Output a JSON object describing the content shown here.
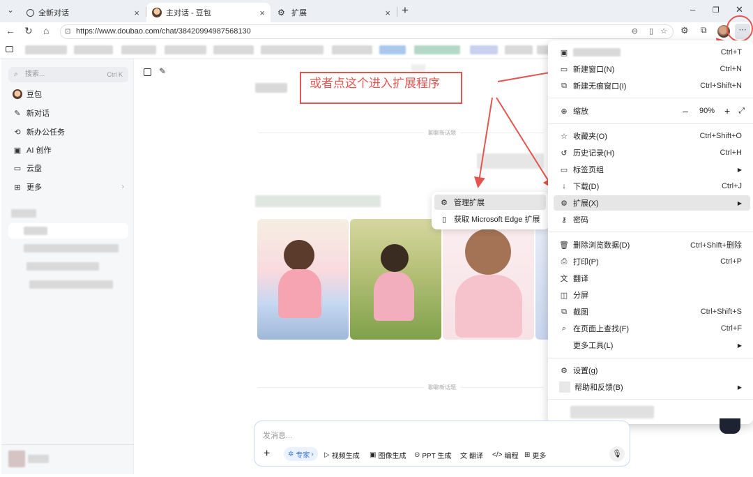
{
  "tabs": [
    {
      "title": "全新对话"
    },
    {
      "title": "主对话 - 豆包"
    },
    {
      "title": "扩展"
    }
  ],
  "address": {
    "url": "https://www.doubao.com/chat/38420994987568130"
  },
  "sidebar": {
    "search_placeholder": "搜索...",
    "search_shortcut": "Ctrl K",
    "items": [
      {
        "label": "豆包",
        "icon": "doubao-avatar-icon"
      },
      {
        "label": "新对话",
        "icon": "edit-icon"
      },
      {
        "label": "新办公任务",
        "icon": "office-task-icon"
      },
      {
        "label": "AI 创作",
        "icon": "image-icon"
      },
      {
        "label": "云盘",
        "icon": "folder-icon"
      },
      {
        "label": "更多",
        "icon": "grid-icon"
      }
    ]
  },
  "main": {
    "divider_text": "聊聊新话题",
    "annotation": "或者点这个进入扩展程序"
  },
  "input": {
    "placeholder": "发消息...",
    "tools": [
      "专家",
      "视频生成",
      "图像生成",
      "PPT 生成",
      "翻译",
      "编程",
      "更多"
    ]
  },
  "submenu": {
    "items": [
      {
        "label": "管理扩展",
        "icon": "puzzle-icon"
      },
      {
        "label": "获取 Microsoft Edge 扩展",
        "icon": "store-icon"
      }
    ]
  },
  "menu": {
    "new_tab_shortcut": "Ctrl+T",
    "items": [
      {
        "label": "新建窗口(N)",
        "shortcut": "Ctrl+N",
        "icon": "window-icon"
      },
      {
        "label": "新建无痕窗口(I)",
        "shortcut": "Ctrl+Shift+N",
        "icon": "inprivate-icon"
      },
      {
        "label": "缩放",
        "zoom": "90%",
        "icon": "zoom-icon"
      },
      {
        "label": "收藏夹(O)",
        "shortcut": "Ctrl+Shift+O",
        "icon": "star-icon"
      },
      {
        "label": "历史记录(H)",
        "shortcut": "Ctrl+H",
        "icon": "history-icon"
      },
      {
        "label": "标签页组",
        "shortcut": "",
        "icon": "tab-group-icon"
      },
      {
        "label": "下载(D)",
        "shortcut": "Ctrl+J",
        "icon": "download-icon"
      },
      {
        "label": "扩展(X)",
        "shortcut": "",
        "icon": "puzzle-icon"
      },
      {
        "label": "密码",
        "shortcut": "",
        "icon": "key-icon"
      },
      {
        "label": "删除浏览数据(D)",
        "shortcut": "Ctrl+Shift+删除",
        "icon": "trash-icon"
      },
      {
        "label": "打印(P)",
        "shortcut": "Ctrl+P",
        "icon": "print-icon"
      },
      {
        "label": "翻译",
        "shortcut": "",
        "icon": "translate-icon"
      },
      {
        "label": "分屏",
        "shortcut": "",
        "icon": "split-screen-icon"
      },
      {
        "label": "截图",
        "shortcut": "Ctrl+Shift+S",
        "icon": "screenshot-icon"
      },
      {
        "label": "在页面上查找(F)",
        "shortcut": "Ctrl+F",
        "icon": "find-icon"
      },
      {
        "label": "更多工具(L)",
        "shortcut": "",
        "icon": ""
      },
      {
        "label": "设置(g)",
        "shortcut": "",
        "icon": "gear-icon"
      },
      {
        "label": "帮助和反馈(B)",
        "shortcut": "",
        "icon": ""
      }
    ]
  },
  "colors": {
    "accent_red": "#e25550",
    "highlight": "#e6e6e6",
    "tab_bar": "#eceff3"
  }
}
